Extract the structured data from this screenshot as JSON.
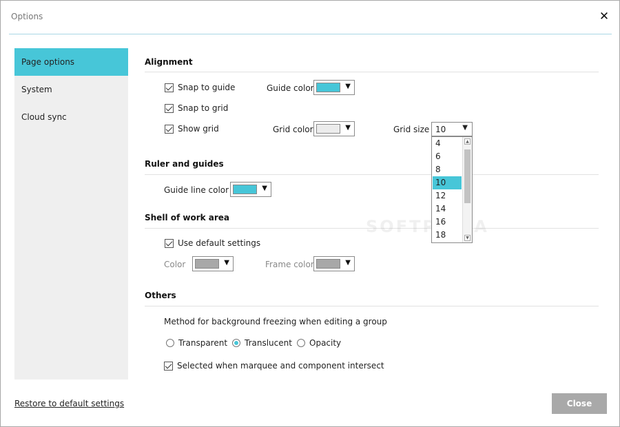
{
  "window": {
    "title": "Options"
  },
  "sidebar": {
    "items": [
      {
        "label": "Page options",
        "active": true
      },
      {
        "label": "System",
        "active": false
      },
      {
        "label": "Cloud sync",
        "active": false
      }
    ]
  },
  "alignment": {
    "title": "Alignment",
    "snap_to_guide": {
      "label": "Snap to guide",
      "checked": true
    },
    "snap_to_grid": {
      "label": "Snap to grid",
      "checked": true
    },
    "show_grid": {
      "label": "Show grid",
      "checked": true
    },
    "guide_color": {
      "label": "Guide color",
      "color": "#47c6d8"
    },
    "grid_color": {
      "label": "Grid color",
      "color": "#ececec"
    },
    "grid_size": {
      "label": "Grid size",
      "value": "10",
      "options": [
        "4",
        "6",
        "8",
        "10",
        "12",
        "14",
        "16",
        "18"
      ]
    }
  },
  "ruler": {
    "title": "Ruler and guides",
    "guide_line_color": {
      "label": "Guide line color",
      "color": "#47c6d8"
    }
  },
  "shell": {
    "title": "Shell of work area",
    "use_default": {
      "label": "Use default settings",
      "checked": true
    },
    "color": {
      "label": "Color",
      "color": "#a8a8a8"
    },
    "frame_color": {
      "label": "Frame color",
      "color": "#a8a8a8"
    }
  },
  "others": {
    "title": "Others",
    "method_label": "Method for background freezing when editing a group",
    "options": [
      {
        "label": "Transparent",
        "selected": false
      },
      {
        "label": "Translucent",
        "selected": true
      },
      {
        "label": "Opacity",
        "selected": false
      }
    ],
    "marquee": {
      "label": "Selected when marquee and component intersect",
      "checked": true
    }
  },
  "footer": {
    "restore_label": "Restore to default settings",
    "close_label": "Close"
  },
  "watermark": "SOFTPEDIA",
  "icons": {
    "close": "close-icon",
    "dropdown": "chevron-down-icon",
    "checkbox": "checkmark-icon",
    "scroll_up": "scroll-up-icon",
    "scroll_down": "scroll-down-icon"
  },
  "theme": {
    "accent": "#47c6d8",
    "button_gray": "#a9a9a9"
  }
}
